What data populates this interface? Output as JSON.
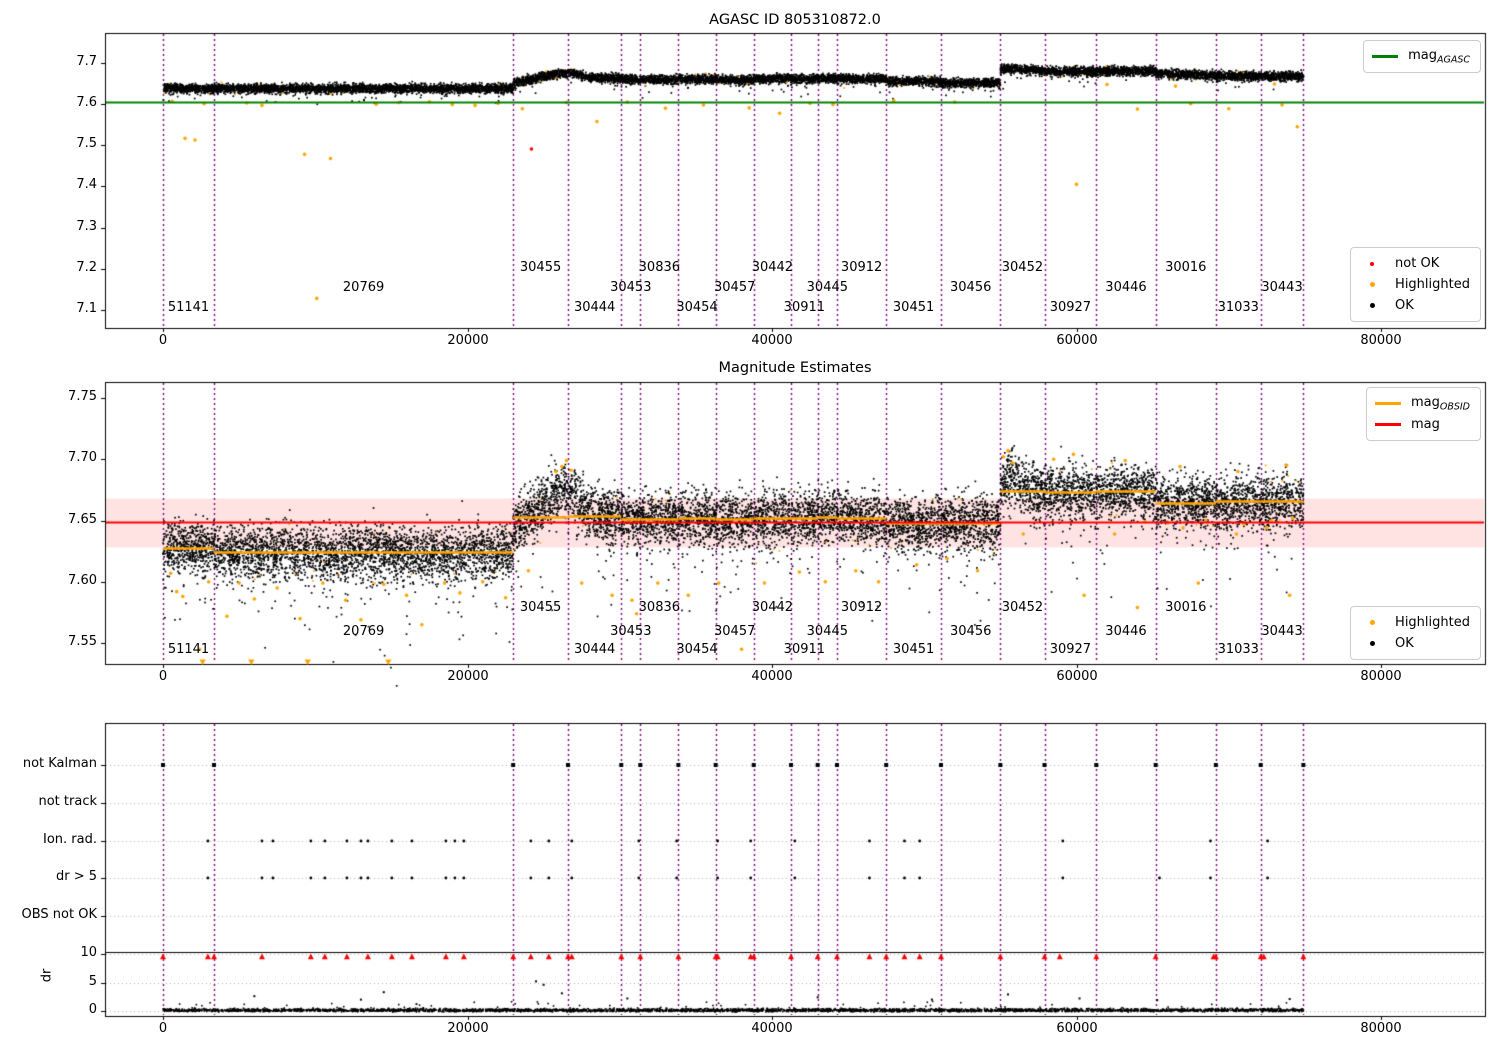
{
  "colors": {
    "background": "#ffffff",
    "frame": "#000000",
    "obs_boundary_line": "#800080",
    "mag_agasc_line": "#008000",
    "mag_line": "#ff0000",
    "mag_obsid_line": "#ffa500",
    "mag_band_fill": "rgba(255,0,0,0.11)",
    "ok_marker": "#000000",
    "highlighted_marker": "#ffa500",
    "not_ok_marker": "#ff0000",
    "gridline": "#b0b0b0",
    "dr_limit_line": "#000000"
  },
  "legends": {
    "top_line": {
      "label_main": "mag",
      "label_sub": "AGASC"
    },
    "top_markers": [
      {
        "label": "not OK",
        "color": "#ff0000"
      },
      {
        "label": "Highlighted",
        "color": "#ffa500"
      },
      {
        "label": "OK",
        "color": "#000000"
      }
    ],
    "middle_lines": [
      {
        "label_main": "mag",
        "label_sub": "OBSID",
        "color": "#ffa500"
      },
      {
        "label_main": "mag",
        "label_sub": "",
        "color": "#ff0000"
      }
    ],
    "middle_markers": [
      {
        "label": "Highlighted",
        "color": "#ffa500"
      },
      {
        "label": "OK",
        "color": "#000000"
      }
    ]
  },
  "chart_data": {
    "shared": {
      "xlim": [
        -3810,
        86830
      ],
      "xticks": [
        0,
        20000,
        40000,
        60000,
        80000
      ],
      "boundaries": [
        0,
        3350,
        23000,
        26600,
        30100,
        31350,
        33850,
        36300,
        38800,
        41250,
        43000,
        44270,
        47500,
        51100,
        55000,
        57900,
        61300,
        65200,
        69150,
        72100,
        74900
      ],
      "segments": [
        {
          "obsid": "51141",
          "start": 0,
          "end": 3350,
          "top_mag": 7.638,
          "mid_mag": 7.628
        },
        {
          "obsid": "20769",
          "start": 3350,
          "end": 23000,
          "top_mag": 7.638,
          "mid_mag": 7.624
        },
        {
          "obsid": "30455",
          "start": 23000,
          "end": 26600,
          "top_mag": 7.658,
          "mid_mag": 7.653,
          "bump_top": [
            [
              0,
              -0.006
            ],
            [
              0.7,
              0.014
            ],
            [
              1,
              0.018
            ]
          ],
          "bump_mid": [
            [
              0,
              -0.01
            ],
            [
              0.7,
              0.018
            ],
            [
              1,
              0.024
            ]
          ]
        },
        {
          "obsid": "30444",
          "start": 26600,
          "end": 30100,
          "top_mag": 7.664,
          "mid_mag": 7.654,
          "bump_top": [
            [
              0,
              0.014
            ],
            [
              0.4,
              0.002
            ],
            [
              1,
              -0.002
            ]
          ],
          "bump_mid": [
            [
              0,
              0.02
            ],
            [
              0.4,
              0.003
            ],
            [
              1,
              -0.001
            ]
          ]
        },
        {
          "obsid": "30453",
          "start": 30100,
          "end": 31350,
          "top_mag": 7.66,
          "mid_mag": 7.651
        },
        {
          "obsid": "30836",
          "start": 31350,
          "end": 33850,
          "top_mag": 7.66,
          "mid_mag": 7.651
        },
        {
          "obsid": "30454",
          "start": 33850,
          "end": 36300,
          "top_mag": 7.661,
          "mid_mag": 7.652
        },
        {
          "obsid": "30457",
          "start": 36300,
          "end": 38800,
          "top_mag": 7.66,
          "mid_mag": 7.651
        },
        {
          "obsid": "30442",
          "start": 38800,
          "end": 41250,
          "top_mag": 7.662,
          "mid_mag": 7.652
        },
        {
          "obsid": "30911",
          "start": 41250,
          "end": 43000,
          "top_mag": 7.662,
          "mid_mag": 7.652
        },
        {
          "obsid": "30445",
          "start": 43000,
          "end": 44270,
          "top_mag": 7.663,
          "mid_mag": 7.653
        },
        {
          "obsid": "30912",
          "start": 44270,
          "end": 47500,
          "top_mag": 7.662,
          "mid_mag": 7.652
        },
        {
          "obsid": "30451",
          "start": 47500,
          "end": 51100,
          "top_mag": 7.656,
          "mid_mag": 7.648
        },
        {
          "obsid": "30456",
          "start": 51100,
          "end": 55000,
          "top_mag": 7.652,
          "mid_mag": 7.648
        },
        {
          "obsid": "30452",
          "start": 55000,
          "end": 57900,
          "top_mag": 7.682,
          "mid_mag": 7.674,
          "bump_top": [
            [
              0,
              0.002
            ],
            [
              0.3,
              0.005
            ],
            [
              1,
              -0.001
            ]
          ],
          "bump_mid": [
            [
              0,
              0.006
            ],
            [
              0.2,
              0.012
            ],
            [
              0.6,
              0.002
            ],
            [
              1,
              0
            ]
          ]
        },
        {
          "obsid": "30927",
          "start": 57900,
          "end": 61300,
          "top_mag": 7.68,
          "mid_mag": 7.673
        },
        {
          "obsid": "30446",
          "start": 61300,
          "end": 65200,
          "top_mag": 7.681,
          "mid_mag": 7.674
        },
        {
          "obsid": "30016",
          "start": 65200,
          "end": 69150,
          "top_mag": 7.672,
          "mid_mag": 7.664,
          "bump_top": [
            [
              0,
              0.004
            ],
            [
              1,
              -0.003
            ]
          ]
        },
        {
          "obsid": "31033",
          "start": 69150,
          "end": 72100,
          "top_mag": 7.669,
          "mid_mag": 7.666
        },
        {
          "obsid": "30443",
          "start": 72100,
          "end": 74900,
          "top_mag": 7.668,
          "mid_mag": 7.666
        }
      ]
    },
    "top": {
      "type": "scatter",
      "title": "AGASC ID 805310872.0",
      "ylim": [
        7.056,
        7.773
      ],
      "yticks": [
        7.1,
        7.2,
        7.3,
        7.4,
        7.5,
        7.6,
        7.7
      ],
      "mag_agasc": 7.606,
      "outliers_highlighted": [
        [
          600,
          7.607
        ],
        [
          1450,
          7.517
        ],
        [
          2100,
          7.513
        ],
        [
          2700,
          7.601
        ],
        [
          5500,
          7.603
        ],
        [
          6500,
          7.597
        ],
        [
          9300,
          7.478
        ],
        [
          10100,
          7.128
        ],
        [
          11000,
          7.468
        ],
        [
          14000,
          7.6
        ],
        [
          15500,
          7.604
        ],
        [
          17500,
          7.606
        ],
        [
          19000,
          7.599
        ],
        [
          20500,
          7.597
        ],
        [
          22000,
          7.602
        ],
        [
          23600,
          7.589
        ],
        [
          26500,
          7.604
        ],
        [
          28500,
          7.558
        ],
        [
          30500,
          7.605
        ],
        [
          33000,
          7.59
        ],
        [
          35500,
          7.598
        ],
        [
          38500,
          7.591
        ],
        [
          40500,
          7.578
        ],
        [
          42500,
          7.602
        ],
        [
          44000,
          7.599
        ],
        [
          48000,
          7.608
        ],
        [
          52000,
          7.605
        ],
        [
          60000,
          7.405
        ],
        [
          62000,
          7.648
        ],
        [
          64000,
          7.588
        ],
        [
          66500,
          7.644
        ],
        [
          67500,
          7.601
        ],
        [
          70000,
          7.589
        ],
        [
          73000,
          7.649
        ],
        [
          73500,
          7.598
        ],
        [
          74500,
          7.545
        ]
      ],
      "outliers_not_ok": [
        [
          24200,
          7.491
        ]
      ]
    },
    "middle": {
      "type": "scatter",
      "title": "Magnitude Estimates",
      "ylim": [
        7.533,
        7.763
      ],
      "yticks": [
        7.55,
        7.6,
        7.65,
        7.7,
        7.75
      ],
      "mag": 7.649,
      "mag_band": [
        7.628,
        7.668
      ],
      "outliers_highlighted": [
        [
          500,
          7.607
        ],
        [
          900,
          7.592
        ],
        [
          1300,
          7.588
        ],
        [
          2400,
          7.545
        ],
        [
          3000,
          7.6
        ],
        [
          4200,
          7.572
        ],
        [
          5000,
          7.599
        ],
        [
          6000,
          7.586
        ],
        [
          7500,
          7.595
        ],
        [
          9000,
          7.57
        ],
        [
          10500,
          7.599
        ],
        [
          12000,
          7.585
        ],
        [
          13000,
          7.569
        ],
        [
          14500,
          7.598
        ],
        [
          16000,
          7.589
        ],
        [
          17000,
          7.565
        ],
        [
          18500,
          7.599
        ],
        [
          19500,
          7.591
        ],
        [
          21000,
          7.6
        ],
        [
          22500,
          7.587
        ],
        [
          24000,
          7.609
        ],
        [
          25800,
          7.69
        ],
        [
          26200,
          7.694
        ],
        [
          26500,
          7.699
        ],
        [
          26800,
          7.691
        ],
        [
          27500,
          7.599
        ],
        [
          29500,
          7.589
        ],
        [
          30800,
          7.585
        ],
        [
          31100,
          7.574
        ],
        [
          32500,
          7.599
        ],
        [
          34500,
          7.589
        ],
        [
          36500,
          7.599
        ],
        [
          38000,
          7.545
        ],
        [
          39500,
          7.599
        ],
        [
          41800,
          7.608
        ],
        [
          43500,
          7.6
        ],
        [
          45500,
          7.609
        ],
        [
          47000,
          7.6
        ],
        [
          49500,
          7.614
        ],
        [
          51500,
          7.619
        ],
        [
          53500,
          7.609
        ],
        [
          55200,
          7.702
        ],
        [
          55500,
          7.707
        ],
        [
          55800,
          7.697
        ],
        [
          56500,
          7.639
        ],
        [
          58500,
          7.7
        ],
        [
          59800,
          7.704
        ],
        [
          60500,
          7.589
        ],
        [
          62500,
          7.639
        ],
        [
          63200,
          7.699
        ],
        [
          64000,
          7.579
        ],
        [
          64500,
          7.649
        ],
        [
          66000,
          7.648
        ],
        [
          66800,
          7.694
        ],
        [
          67000,
          7.644
        ],
        [
          68000,
          7.599
        ],
        [
          68500,
          7.65
        ],
        [
          70500,
          7.639
        ],
        [
          70600,
          7.69
        ],
        [
          71000,
          7.647
        ],
        [
          72500,
          7.644
        ],
        [
          72800,
          7.65
        ],
        [
          73800,
          7.695
        ],
        [
          74000,
          7.589
        ],
        [
          74200,
          7.652
        ]
      ],
      "clipped_low_x": [
        2600,
        5800,
        9500,
        14800
      ],
      "clip_low_value": 7.5345
    },
    "bottom": {
      "type": "scatter",
      "categories": [
        "not Kalman",
        "not track",
        "Ion. rad.",
        "dr > 5",
        "OBS not OK"
      ],
      "dr_ticks": [
        10,
        5,
        0
      ],
      "ylabel": "dr",
      "dr_limit_line": 10,
      "not_kalman_x": [
        0,
        3350,
        23000,
        26600,
        30100,
        31350,
        33850,
        36300,
        38800,
        41250,
        43000,
        44270,
        47500,
        51100,
        55000,
        57900,
        61300,
        65200,
        69150,
        72100,
        74900
      ],
      "not_track_x": [],
      "ion_rad_x": [
        2950,
        6500,
        7220,
        9710,
        10630,
        12080,
        13000,
        13460,
        15030,
        16350,
        18580,
        19170,
        19760,
        24160,
        25340,
        26850,
        31250,
        33740,
        36430,
        38600,
        41500,
        46400,
        48700,
        49700,
        59100,
        68800,
        72550
      ],
      "dr_gt5_x": [
        2950,
        6500,
        7220,
        9710,
        10630,
        12080,
        13000,
        13460,
        15030,
        16350,
        18580,
        19170,
        19760,
        24160,
        25340,
        26850,
        31250,
        33740,
        36430,
        38600,
        41500,
        46400,
        48700,
        49700,
        59100,
        65450,
        68800,
        72550
      ],
      "obs_not_ok_x": [],
      "dr_clipped_x": [
        0,
        2950,
        3350,
        6500,
        9710,
        10630,
        12080,
        13460,
        15030,
        16350,
        18580,
        19760,
        23000,
        24160,
        25340,
        26600,
        26850,
        30100,
        31350,
        33850,
        36300,
        36430,
        38600,
        38800,
        41250,
        43000,
        44270,
        46400,
        47500,
        48700,
        49700,
        51100,
        55000,
        57900,
        58900,
        61300,
        65200,
        69000,
        69150,
        72100,
        72300,
        74900
      ],
      "dr_extra": [
        [
          6000,
          2.6
        ],
        [
          13000,
          2.0
        ],
        [
          14500,
          3.3
        ],
        [
          24500,
          5.2
        ],
        [
          25000,
          4.6
        ],
        [
          26200,
          3.1
        ],
        [
          30500,
          2.2
        ],
        [
          43000,
          2.4
        ],
        [
          50500,
          2.0
        ],
        [
          55500,
          2.9
        ],
        [
          60200,
          2.2
        ],
        [
          65300,
          1.9
        ],
        [
          74000,
          2.1
        ]
      ]
    }
  }
}
